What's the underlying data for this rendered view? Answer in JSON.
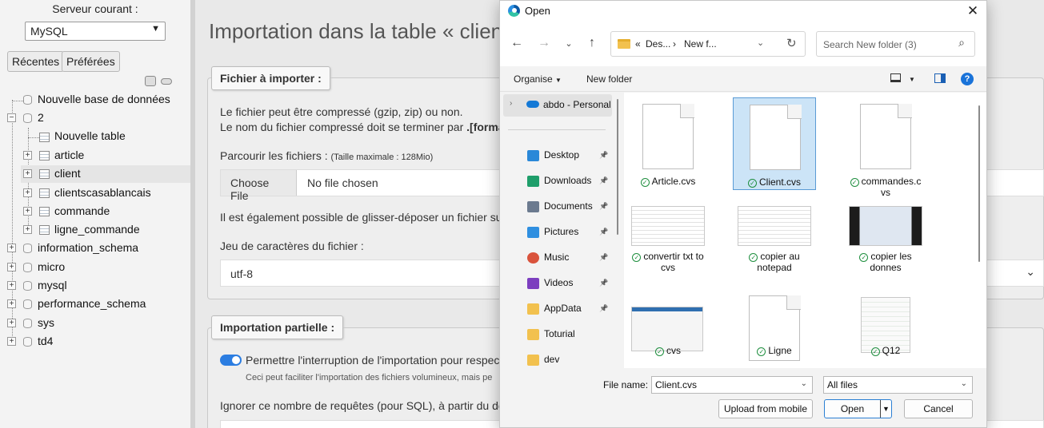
{
  "nav": {
    "server_label": "Serveur courant :",
    "server_value": "MySQL",
    "tab_recent": "Récentes",
    "tab_favorites": "Préférées",
    "new_db": "Nouvelle base de données",
    "databases": [
      {
        "label": "2"
      },
      {
        "label": "information_schema"
      },
      {
        "label": "micro"
      },
      {
        "label": "mysql"
      },
      {
        "label": "performance_schema"
      },
      {
        "label": "sys"
      },
      {
        "label": "td4"
      }
    ],
    "db2_children": {
      "new_table": "Nouvelle table",
      "tables": [
        "article",
        "client",
        "clientscasablancais",
        "commande",
        "ligne_commande"
      ]
    }
  },
  "main": {
    "title": "Importation dans la table « clien",
    "file_section": {
      "legend": "Fichier à importer :",
      "line1": "Le fichier peut être compressé (gzip, zip) ou non.",
      "line2_prefix": "Le nom du fichier compressé doit se terminer par ",
      "line2_bold": ".[format].[",
      "browse_label": "Parcourir les fichiers : ",
      "max_size": "(Taille maximale : 128Mio)",
      "choose_button": "Choose File",
      "no_file": "No file chosen",
      "drag_drop": "Il est également possible de glisser-déposer un fichier sur n'",
      "charset_label": "Jeu de caractères du fichier :",
      "charset_value": "utf-8"
    },
    "partial_section": {
      "legend": "Importation partielle :",
      "interrupt_label": "Permettre l'interruption de l'importation pour respecter",
      "interrupt_hint": "Ceci peut faciliter l'importation des fichiers volumineux, mais pe",
      "skip_label": "Ignorer ce nombre de requêtes (pour SQL), à partir du débu"
    }
  },
  "dialog": {
    "title": "Open",
    "address": {
      "prefix": "«",
      "seg1": "Des...",
      "seg2": "New f..."
    },
    "search_placeholder": "Search New folder (3)",
    "organise": "Organise",
    "new_folder": "New folder",
    "help": "?",
    "sidebar": {
      "cloud": "abdo - Personal",
      "items": [
        {
          "label": "Desktop",
          "icon": "desktop-icon",
          "color": "#2a88d8",
          "pinned": true
        },
        {
          "label": "Downloads",
          "icon": "downloads-icon",
          "color": "#1e9e6a",
          "pinned": true
        },
        {
          "label": "Documents",
          "icon": "documents-icon",
          "color": "#6b7a8f",
          "pinned": true
        },
        {
          "label": "Pictures",
          "icon": "pictures-icon",
          "color": "#2f8fe0",
          "pinned": true
        },
        {
          "label": "Music",
          "icon": "music-icon",
          "color": "#d9533c",
          "pinned": true
        },
        {
          "label": "Videos",
          "icon": "videos-icon",
          "color": "#7c3ebf",
          "pinned": true
        },
        {
          "label": "AppData",
          "icon": "folder-icon",
          "color": "#f2c14e",
          "pinned": true
        },
        {
          "label": "Toturial",
          "icon": "folder-icon",
          "color": "#f2c14e",
          "pinned": false
        },
        {
          "label": "dev",
          "icon": "folder-icon",
          "color": "#f2c14e",
          "pinned": false
        }
      ]
    },
    "files": [
      {
        "label": "Article.cvs",
        "kind": "doc",
        "selected": false
      },
      {
        "label": "Client.cvs",
        "kind": "doc",
        "selected": true
      },
      {
        "label": "commandes.c\nvs",
        "kind": "doc",
        "selected": false
      },
      {
        "label": "convertir txt to\ncvs",
        "kind": "thumb-doc",
        "selected": false
      },
      {
        "label": "copier au\nnotepad",
        "kind": "thumb-notepad",
        "selected": false
      },
      {
        "label": "copier les\ndonnes",
        "kind": "thumb-dark",
        "selected": false
      },
      {
        "label": "cvs",
        "kind": "thumb-win",
        "selected": false
      },
      {
        "label": "Ligne",
        "kind": "doc",
        "selected": false
      },
      {
        "label": "Q12",
        "kind": "thumb-code",
        "selected": false
      }
    ],
    "file_name_label": "File name:",
    "file_name_value": "Client.cvs",
    "file_type_value": "All files",
    "upload_button": "Upload from mobile",
    "open_button": "Open",
    "cancel_button": "Cancel"
  }
}
